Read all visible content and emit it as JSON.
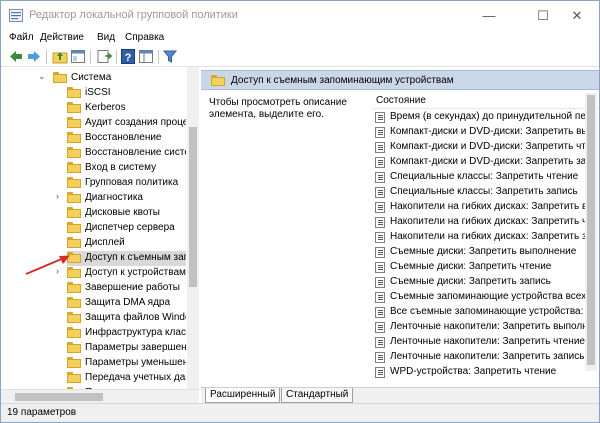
{
  "window": {
    "title": "Редактор локальной групповой политики",
    "controls": {
      "minimize": "—",
      "maximize": "☐",
      "close": "✕"
    }
  },
  "menu": [
    "Файл",
    "Действие",
    "Вид",
    "Справка"
  ],
  "toolbar": [
    "back-icon",
    "forward-icon",
    "up-folder-icon",
    "properties-icon",
    "export-list-icon",
    "help-icon",
    "view-pane-icon",
    "filter-icon"
  ],
  "tree": {
    "parent": "Система",
    "items": [
      {
        "label": "iSCSI",
        "expandable": false
      },
      {
        "label": "Kerberos",
        "expandable": false
      },
      {
        "label": "Аудит создания процес",
        "expandable": false
      },
      {
        "label": "Восстановление",
        "expandable": false
      },
      {
        "label": "Восстановление систе",
        "expandable": false
      },
      {
        "label": "Вход в систему",
        "expandable": false
      },
      {
        "label": "Групповая политика",
        "expandable": false
      },
      {
        "label": "Диагностика",
        "expandable": true
      },
      {
        "label": "Дисковые квоты",
        "expandable": false
      },
      {
        "label": "Диспетчер сервера",
        "expandable": false
      },
      {
        "label": "Дисплей",
        "expandable": false
      },
      {
        "label": "Доступ к съемным запо",
        "expandable": false,
        "selected": true
      },
      {
        "label": "Доступ к устройствам E",
        "expandable": true
      },
      {
        "label": "Завершение работы",
        "expandable": false
      },
      {
        "label": "Защита DMA ядра",
        "expandable": false
      },
      {
        "label": "Защита файлов Window",
        "expandable": false
      },
      {
        "label": "Инфраструктура класс",
        "expandable": false
      },
      {
        "label": "Параметры завершени",
        "expandable": false
      },
      {
        "label": "Параметры уменьшени",
        "expandable": false
      },
      {
        "label": "Передача учетных дан",
        "expandable": false
      },
      {
        "label": "Перенаправление папс",
        "expandable": false
      }
    ]
  },
  "right": {
    "header": "Доступ к съемным запоминающим устройствам",
    "description": "Чтобы просмотреть описание элемента, выделите его.",
    "column": "Состояние",
    "policies": [
      "Время (в секундах) до принудительной перез",
      "Компакт-диски и DVD-диски: Запретить выпо",
      "Компакт-диски и DVD-диски: Запретить чтен",
      "Компакт-диски и DVD-диски: Запретить запи",
      "Специальные классы: Запретить чтение",
      "Специальные классы: Запретить запись",
      "Накопители на гибких дисках: Запретить вы",
      "Накопители на гибких дисках: Запретить чте",
      "Накопители на гибких дисках: Запретить зап",
      "Съемные диски: Запретить выполнение",
      "Съемные диски: Запретить чтение",
      "Съемные диски: Запретить запись",
      "Съемные запоминающие устройства всех кл",
      "Все съемные запоминающие устройства: ра",
      "Ленточные накопители: Запретить выполнен",
      "Ленточные накопители: Запретить чтение",
      "Ленточные накопители: Запретить запись",
      "WPD-устройства: Запретить чтение"
    ]
  },
  "tabs": [
    "Расширенный",
    "Стандартный"
  ],
  "status": "19 параметров"
}
